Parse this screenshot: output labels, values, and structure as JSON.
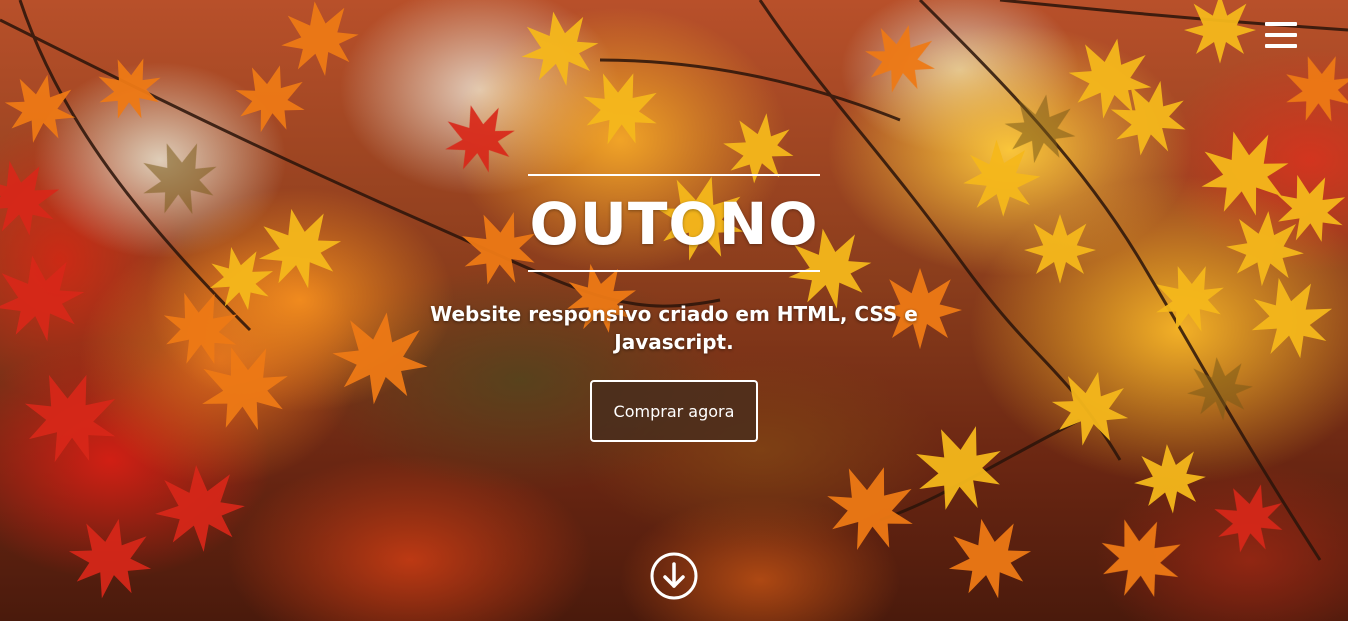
{
  "hero": {
    "title": "OUTONO",
    "subtitle": "Website responsivo criado em HTML, CSS e Javascript.",
    "cta_label": "Comprar agora",
    "background": "autumn-maple-leaves-photo"
  },
  "nav": {
    "menu_icon": "hamburger-menu-icon"
  },
  "scroll": {
    "icon": "arrow-down-circle-icon"
  },
  "colors": {
    "text": "#ffffff",
    "button_bg": "#462d1e",
    "leaf_yellow": "#f5c21a",
    "leaf_orange": "#ee7a16",
    "leaf_red": "#d8281a"
  }
}
